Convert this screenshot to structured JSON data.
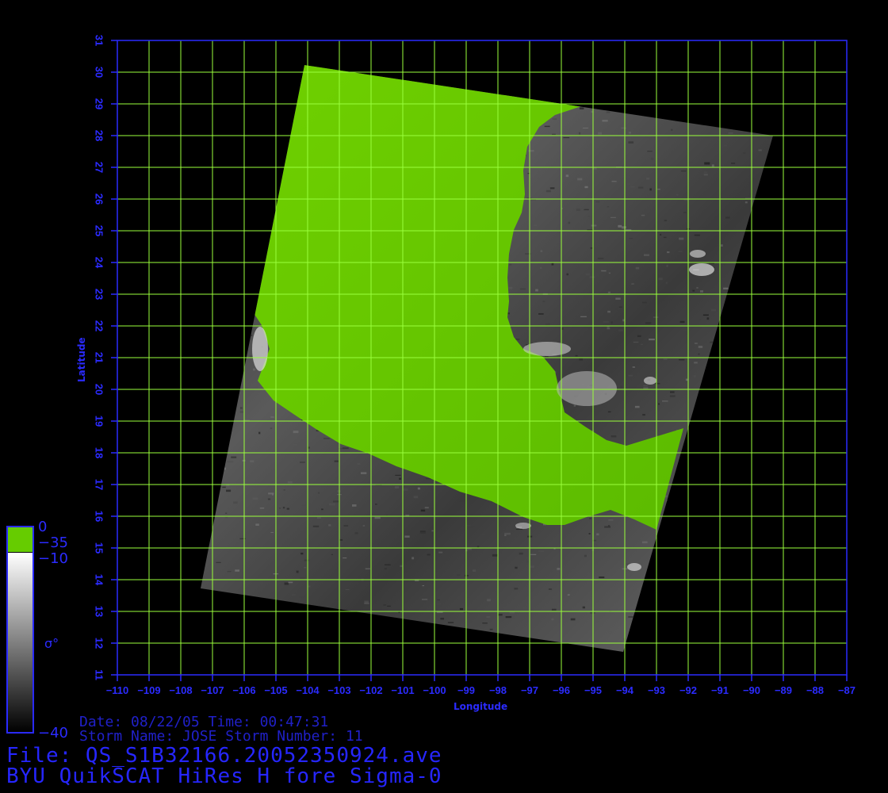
{
  "map": {
    "lon_range": [
      -110,
      -87
    ],
    "lat_range": [
      11,
      31
    ],
    "x_ticks": [
      -110,
      -109,
      -108,
      -107,
      -106,
      -105,
      -104,
      -103,
      -102,
      -101,
      -100,
      -99,
      -98,
      -97,
      -96,
      -95,
      -94,
      -93,
      -92,
      -91,
      -90,
      -89,
      -88,
      -87
    ],
    "y_ticks": [
      11,
      12,
      13,
      14,
      15,
      16,
      17,
      18,
      19,
      20,
      21,
      22,
      23,
      24,
      25,
      26,
      27,
      28,
      29,
      30,
      31
    ],
    "x_label": "Longitude",
    "y_label": "Latitude",
    "grid": true,
    "grid_color": "#9aff3c",
    "frame_color": "#2a2aff",
    "land_color": "#66cc00",
    "background": "#000000",
    "swath_corners_lonlat": [
      [
        -103.9,
        30.2
      ],
      [
        -89.0,
        28.0
      ],
      [
        -93.9,
        11.8
      ],
      [
        -107.3,
        13.8
      ]
    ]
  },
  "legend": {
    "land_max": "0",
    "land_min": "−35",
    "ocean_max": "−10",
    "ocean_min": "−40",
    "symbol": "σ°"
  },
  "info": {
    "date_line": "Date: 08/22/05  Time: 00:47:31",
    "storm_line": "Storm Name: JOSE  Storm Number: 11",
    "file_line": "File: QS_S1B32166.20052350924.ave",
    "product_line": "BYU QuikSCAT HiRes H fore Sigma-0"
  }
}
